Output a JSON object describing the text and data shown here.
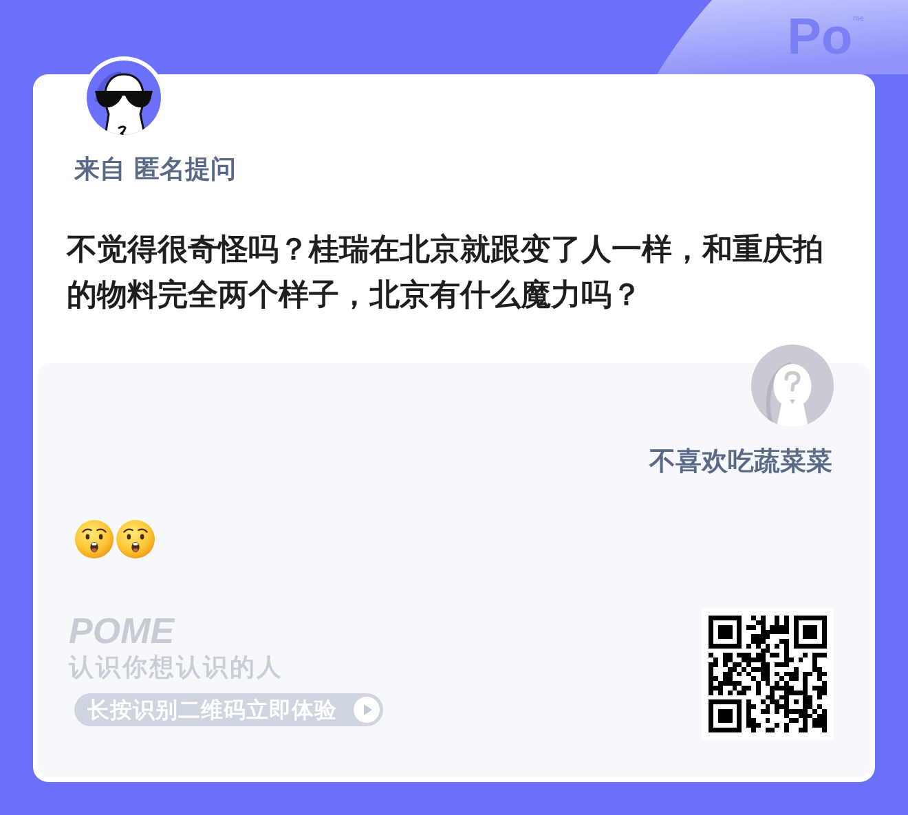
{
  "logo": {
    "text": "Po",
    "superscript": "me"
  },
  "question": {
    "from": "来自 匿名提问",
    "text": "不觉得很奇怪吗？桂瑞在北京就跟变了人一样，和重庆拍的物料完全两个样子，北京有什么魔力吗？"
  },
  "answer": {
    "author": "不喜欢吃蔬菜菜",
    "emojis": [
      {
        "kind": "astonished"
      },
      {
        "kind": "astonished"
      }
    ]
  },
  "footer": {
    "brand": "POME",
    "slogan": "认识你想认识的人",
    "scan_prompt": "长按识别二维码立即体验"
  }
}
